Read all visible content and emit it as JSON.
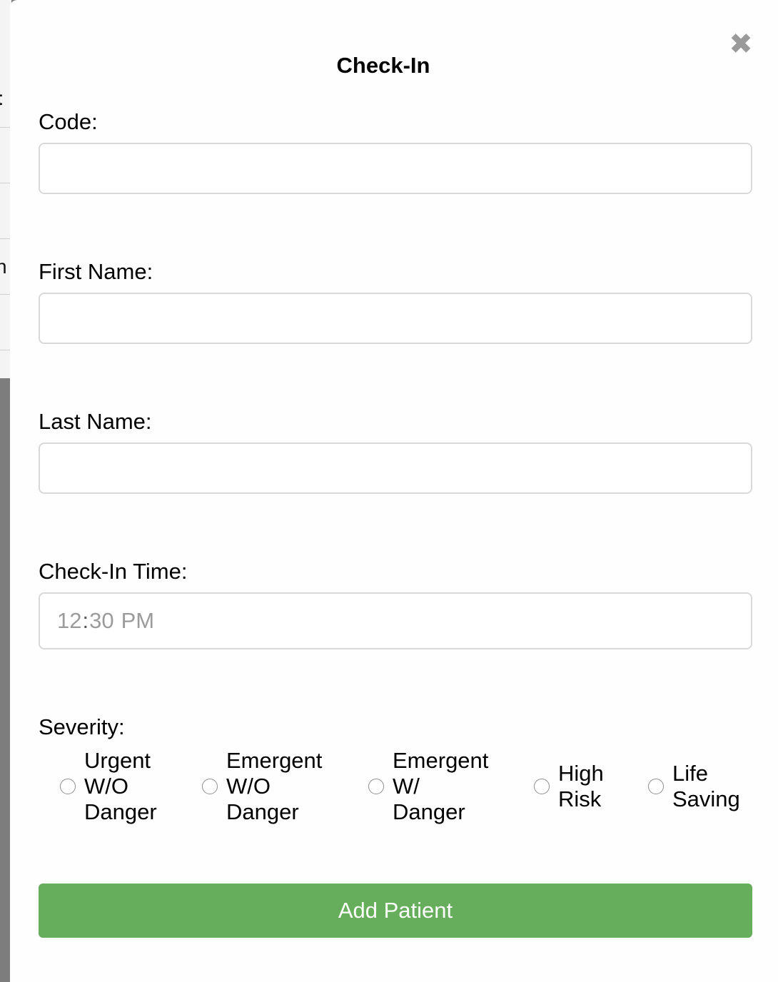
{
  "modal": {
    "title": "Check-In",
    "close_symbol": "✖"
  },
  "background": {
    "glyph_1": "t",
    "glyph_2": "n"
  },
  "form": {
    "code": {
      "label": "Code:",
      "value": "",
      "placeholder": ""
    },
    "first_name": {
      "label": "First Name:",
      "value": "",
      "placeholder": ""
    },
    "last_name": {
      "label": "Last Name:",
      "value": "",
      "placeholder": ""
    },
    "check_in_time": {
      "label": "Check-In Time:",
      "hour": "12",
      "separator": ":",
      "minute": "30",
      "period": "PM"
    },
    "severity": {
      "label": "Severity:",
      "options": [
        {
          "line1": "Urgent",
          "line2": "W/O",
          "line3": "Danger",
          "selected": false
        },
        {
          "line1": "Emergent",
          "line2": "W/O",
          "line3": "Danger",
          "selected": false
        },
        {
          "line1": "Emergent",
          "line2": "W/",
          "line3": "Danger",
          "selected": false
        },
        {
          "line1": "High",
          "line2": "Risk",
          "selected": false
        },
        {
          "line1": "Life",
          "line2": "Saving",
          "selected": false
        }
      ]
    },
    "submit_label": "Add Patient"
  },
  "colors": {
    "submit_background": "#67ae5c",
    "overlay": "#7d7d7d",
    "modal_background": "#fefefe"
  }
}
